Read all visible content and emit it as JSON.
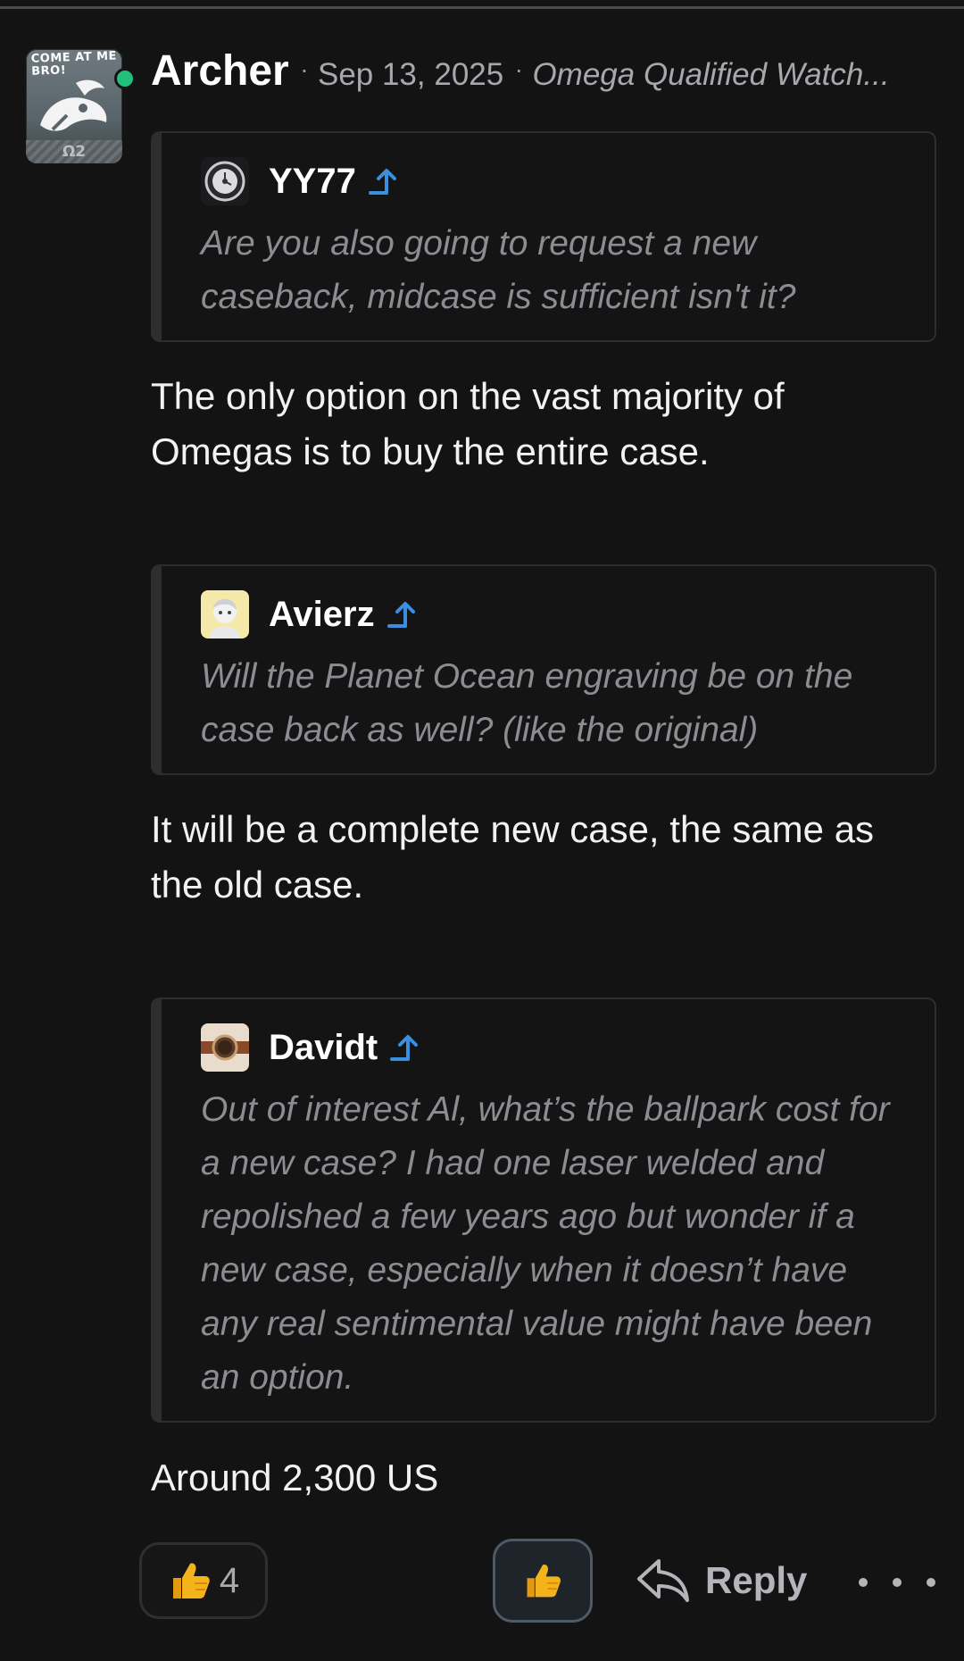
{
  "post": {
    "author": "Archer",
    "separator": "·",
    "date": "Sep 13, 2025",
    "forum": "Omega Qualified Watch...",
    "author_online": true,
    "avatar_text_top": "COME AT ME BRO!",
    "avatar_text_bottom": "Ω2"
  },
  "quotes": [
    {
      "user": "YY77",
      "text": "Are you also going to request a new caseback, midcase is sufficient isn't it?"
    },
    {
      "user": "Avierz",
      "text": "Will the Planet Ocean engraving be on the case back as well? (like the original)"
    },
    {
      "user": "Davidt",
      "text": "Out of interest Al, what’s the ballpark cost for a new case? I had one laser welded and repolished a few years ago but wonder if a new case, especially when it doesn’t have any real sentimental value might have been an option."
    }
  ],
  "replies": [
    "The only option on the vast majority of Omegas is to buy the entire case.",
    "It will be a complete new case, the same as the old case.",
    "Around 2,300 US"
  ],
  "footer": {
    "like_count": "4",
    "reply_label": "Reply",
    "like_icon": "thumbs-up-icon",
    "reply_icon": "reply-arrow-icon",
    "more_icon": "more-dots-icon"
  },
  "colors": {
    "background": "#131314",
    "online": "#22c07a",
    "jump_arrow": "#3b8fe0",
    "quote_text": "#8c8c92",
    "thumb": "#f5b31b"
  }
}
